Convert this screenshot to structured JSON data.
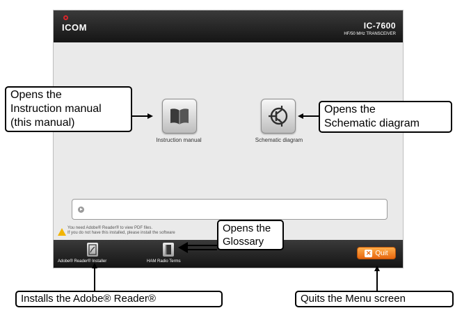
{
  "header": {
    "logo": "ICOM",
    "model": "IC-7600",
    "model_sub": "HF/50 MHz TRANSCEIVER"
  },
  "buttons": {
    "instruction_manual": "Instruction manual",
    "schematic_diagram": "Schematic diagram"
  },
  "info": {
    "warning_line1": "You need Adobe® Reader® to view PDF files.",
    "warning_line2": "If you do not have this installed, please install the software"
  },
  "footer": {
    "adobe_installer": "Adobe® Reader® Installer",
    "ham_terms": "HAM Radio Terms",
    "quit": "Quit"
  },
  "callouts": {
    "instruction": [
      "Opens the",
      "Instruction manual",
      "(this manual)"
    ],
    "schematic": [
      "Opens the",
      "Schematic diagram"
    ],
    "glossary": [
      "Opens the",
      "Glossary"
    ],
    "adobe": "Installs the Adobe® Reader®",
    "quit": "Quits the Menu screen"
  },
  "colors": {
    "header_bg": "#1f1f1f",
    "logo_red": "#d8262b",
    "quit_orange": "#f08a2c",
    "warning_yellow": "#f2b400",
    "window_bg": "#eaeaea"
  },
  "icons": [
    "book-icon",
    "schematic-icon",
    "info-arrow-icon",
    "warning-icon",
    "adobe-reader-icon",
    "glossary-book-icon",
    "close-x-icon"
  ]
}
